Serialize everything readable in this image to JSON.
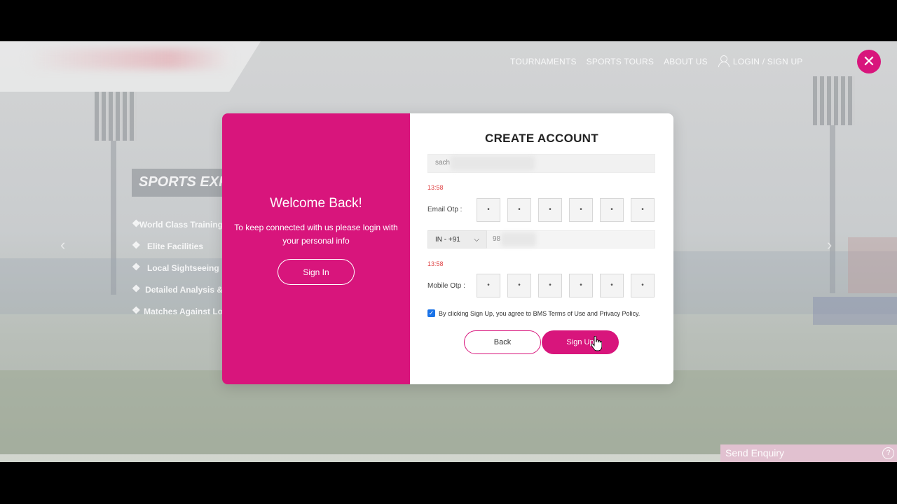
{
  "nav": {
    "items": [
      "TOURNAMENTS",
      "SPORTS TOURS",
      "ABOUT US"
    ],
    "login_label": "LOGIN / SIGN UP"
  },
  "close_symbol": "✕",
  "background": {
    "section_title": "SPORTS EXP",
    "features": [
      "World Class Training",
      "Elite Facilities",
      "Local Sightseeing",
      "Detailed Analysis &",
      "Matches Against Lo"
    ],
    "prev_arrow": "‹",
    "next_arrow": "›"
  },
  "welcome": {
    "title": "Welcome Back!",
    "text": "To keep connected with us please login with your personal info",
    "signin_label": "Sign In"
  },
  "form": {
    "title": "CREATE ACCOUNT",
    "email_value": "sach",
    "email_timer": "13:58",
    "email_otp_label": "Email Otp :",
    "email_otp": [
      "•",
      "•",
      "•",
      "•",
      "•",
      "•"
    ],
    "country_code": "IN - +91",
    "phone_value": "98",
    "mobile_timer": "13:58",
    "mobile_otp_label": "Mobile Otp :",
    "mobile_otp": [
      "•",
      "•",
      "•",
      "•",
      "•",
      "•"
    ],
    "terms_text": "By clicking Sign Up, you agree to BMS Terms of Use and Privacy Policy.",
    "terms_checked": true,
    "back_label": "Back",
    "signup_label": "Sign Up"
  },
  "enquiry": {
    "label": "Send Enquiry",
    "help_symbol": "?"
  },
  "colors": {
    "accent": "#d8157c"
  }
}
